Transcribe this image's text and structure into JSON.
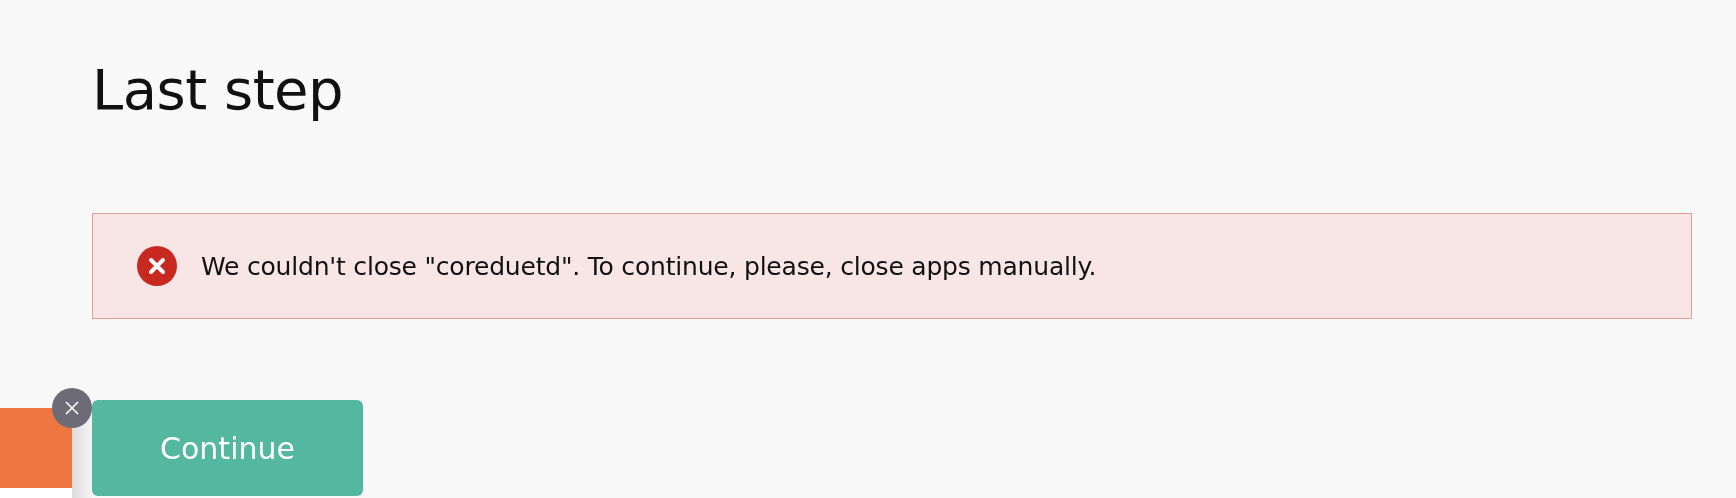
{
  "title": "Last step",
  "alert": {
    "kind": "error",
    "message": "We couldn't close \"coreduetd\". To continue, please, close apps manually."
  },
  "primary_button": {
    "label": "Continue"
  }
}
